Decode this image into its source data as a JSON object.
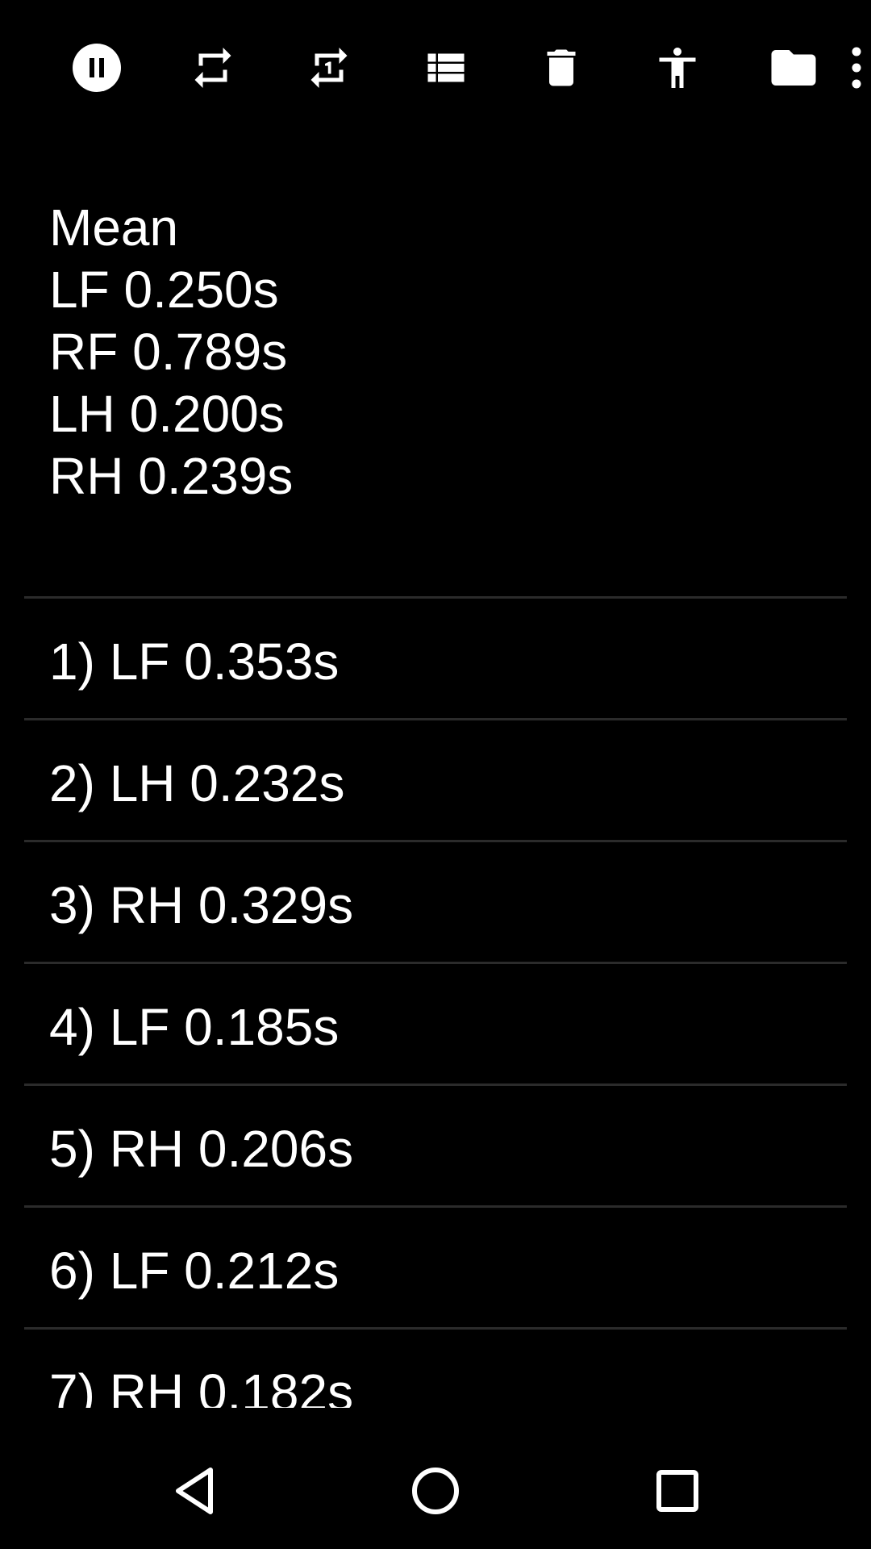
{
  "toolbar": {
    "icons": [
      {
        "name": "pause-icon"
      },
      {
        "name": "repeat-icon"
      },
      {
        "name": "repeat-one-icon"
      },
      {
        "name": "list-icon"
      },
      {
        "name": "delete-icon"
      },
      {
        "name": "accessibility-icon"
      },
      {
        "name": "folder-icon"
      },
      {
        "name": "more-options-icon"
      }
    ]
  },
  "summary": {
    "heading": "Mean",
    "lines": [
      "LF 0.250s",
      "RF 0.789s",
      "LH 0.200s",
      "RH 0.239s"
    ]
  },
  "steps": [
    "1) LF 0.353s",
    "2) LH 0.232s",
    "3) RH 0.329s",
    "4) LF 0.185s",
    "5) RH 0.206s",
    "6) LF 0.212s",
    "7) RH 0.182s"
  ],
  "navigation": {
    "buttons": [
      "back-icon",
      "home-icon",
      "recents-icon"
    ]
  },
  "colors": {
    "background": "#000000",
    "text": "#ffffff",
    "divider": "#2b2b2b"
  }
}
